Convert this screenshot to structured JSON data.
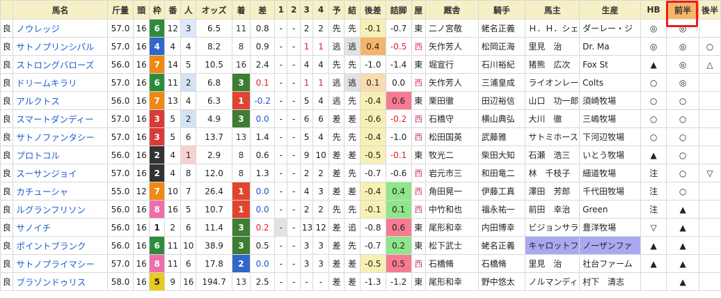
{
  "headers": [
    "",
    "馬名",
    "斤量",
    "頭",
    "枠",
    "番",
    "人",
    "オッズ",
    "着",
    "差",
    "1",
    "2",
    "3",
    "4",
    "予",
    "結",
    "後差",
    "詰脚",
    "屋",
    "厩舎",
    "騎手",
    "馬主",
    "生産",
    "HB",
    "前半",
    "後半"
  ],
  "rows": [
    {
      "baba": "良",
      "name": "ノウレッジ",
      "kin": "57.0",
      "to": "16",
      "waku": "6",
      "ban": "12",
      "nin": "3",
      "odds": "6.5",
      "chaku": "11",
      "sa": "0.8",
      "c1": "-",
      "c2": "-",
      "c3": "2",
      "c4": "2",
      "yo": "先",
      "ke": "先",
      "kosa": "-0.1",
      "tsume": "-0.7",
      "ya": "東",
      "kyu": "二ノ宮敬",
      "kishu": "蛯名正義",
      "owner": "Ｈ．Ｈ．シェ",
      "seisan": "ダーレー・ジ",
      "hb": "◎",
      "zen": "◎",
      "kou": ""
    },
    {
      "baba": "良",
      "name": "サトノプリンシパル",
      "kin": "57.0",
      "to": "16",
      "waku": "4",
      "ban": "4",
      "nin": "4",
      "odds": "8.2",
      "chaku": "8",
      "sa": "0.9",
      "c1": "-",
      "c2": "-",
      "c3": "1",
      "c4": "1",
      "yo": "逃",
      "ke": "逃",
      "kosa": "0.4",
      "tsume": "-0.5",
      "ya": "西",
      "kyu": "矢作芳人",
      "kishu": "松岡正海",
      "owner": "里見　治",
      "seisan": "Dr. Ma",
      "hb": "◎",
      "zen": "◎",
      "kou": "○"
    },
    {
      "baba": "良",
      "name": "ストロングバローズ",
      "kin": "56.0",
      "to": "16",
      "waku": "7",
      "ban": "14",
      "nin": "5",
      "odds": "10.5",
      "chaku": "16",
      "sa": "2.4",
      "c1": "-",
      "c2": "-",
      "c3": "4",
      "c4": "4",
      "yo": "先",
      "ke": "先",
      "kosa": "-1.0",
      "tsume": "-1.4",
      "ya": "東",
      "kyu": "堀宣行",
      "kishu": "石川裕紀",
      "owner": "猪熊　広次",
      "seisan": "Fox St",
      "hb": "▲",
      "zen": "◎",
      "kou": "△"
    },
    {
      "baba": "良",
      "name": "ドリームキラリ",
      "kin": "57.0",
      "to": "16",
      "waku": "6",
      "ban": "11",
      "nin": "2",
      "odds": "6.8",
      "chaku": "3",
      "sa": "0.1",
      "c1": "-",
      "c2": "-",
      "c3": "1",
      "c4": "1",
      "yo": "逃",
      "ke": "逃",
      "kosa": "0.1",
      "tsume": "0.0",
      "ya": "西",
      "kyu": "矢作芳人",
      "kishu": "三浦皇成",
      "owner": "ライオンレー",
      "seisan": "Colts",
      "hb": "○",
      "zen": "◎",
      "kou": ""
    },
    {
      "baba": "良",
      "name": "アルクトス",
      "kin": "56.0",
      "to": "16",
      "waku": "7",
      "ban": "13",
      "nin": "4",
      "odds": "6.3",
      "chaku": "1",
      "sa": "-0.2",
      "c1": "-",
      "c2": "-",
      "c3": "5",
      "c4": "4",
      "yo": "逃",
      "ke": "先",
      "kosa": "-0.4",
      "tsume": "0.6",
      "ya": "東",
      "kyu": "栗田徹",
      "kishu": "田辺裕信",
      "owner": "山口　功一郎",
      "seisan": "須崎牧場",
      "hb": "○",
      "zen": "○",
      "kou": ""
    },
    {
      "baba": "良",
      "name": "スマートダンディー",
      "kin": "57.0",
      "to": "16",
      "waku": "3",
      "ban": "5",
      "nin": "2",
      "odds": "4.9",
      "chaku": "3",
      "sa": "0.0",
      "c1": "-",
      "c2": "-",
      "c3": "6",
      "c4": "6",
      "yo": "差",
      "ke": "差",
      "kosa": "-0.6",
      "tsume": "-0.2",
      "ya": "西",
      "kyu": "石橋守",
      "kishu": "横山典弘",
      "owner": "大川　徹",
      "seisan": "三嶋牧場",
      "hb": "○",
      "zen": "○",
      "kou": ""
    },
    {
      "baba": "良",
      "name": "サトノファンタシー",
      "kin": "57.0",
      "to": "16",
      "waku": "3",
      "ban": "5",
      "nin": "6",
      "odds": "13.7",
      "chaku": "13",
      "sa": "1.4",
      "c1": "-",
      "c2": "-",
      "c3": "5",
      "c4": "4",
      "yo": "先",
      "ke": "先",
      "kosa": "-0.4",
      "tsume": "-1.0",
      "ya": "西",
      "kyu": "松田国英",
      "kishu": "武藤雅",
      "owner": "サトミホース",
      "seisan": "下河辺牧場",
      "hb": "○",
      "zen": "○",
      "kou": ""
    },
    {
      "baba": "良",
      "name": "プロトコル",
      "kin": "56.0",
      "to": "16",
      "waku": "2",
      "ban": "4",
      "nin": "1",
      "odds": "2.9",
      "chaku": "8",
      "sa": "0.6",
      "c1": "-",
      "c2": "-",
      "c3": "9",
      "c4": "10",
      "yo": "差",
      "ke": "差",
      "kosa": "-0.5",
      "tsume": "-0.1",
      "ya": "東",
      "kyu": "牧光二",
      "kishu": "柴田大知",
      "owner": "石瀬　浩三",
      "seisan": "いとう牧場",
      "hb": "▲",
      "zen": "○",
      "kou": ""
    },
    {
      "baba": "良",
      "name": "スーサンジョイ",
      "kin": "57.0",
      "to": "16",
      "waku": "2",
      "ban": "4",
      "nin": "8",
      "odds": "12.0",
      "chaku": "8",
      "sa": "1.3",
      "c1": "-",
      "c2": "-",
      "c3": "2",
      "c4": "2",
      "yo": "差",
      "ke": "先",
      "kosa": "-0.7",
      "tsume": "-0.6",
      "ya": "西",
      "kyu": "岩元市三",
      "kishu": "和田竜二",
      "owner": "林　千枝子",
      "seisan": "細道牧場",
      "hb": "注",
      "zen": "○",
      "kou": "▽"
    },
    {
      "baba": "良",
      "name": "カチューシャ",
      "kin": "55.0",
      "to": "12",
      "waku": "7",
      "ban": "10",
      "nin": "7",
      "odds": "26.4",
      "chaku": "1",
      "sa": "0.0",
      "c1": "-",
      "c2": "-",
      "c3": "4",
      "c4": "3",
      "yo": "差",
      "ke": "差",
      "kosa": "-0.4",
      "tsume": "0.4",
      "ya": "西",
      "kyu": "角田晃一",
      "kishu": "伊藤工真",
      "owner": "澤田　芳郎",
      "seisan": "千代田牧場",
      "hb": "注",
      "zen": "○",
      "kou": ""
    },
    {
      "baba": "良",
      "name": "ルグランフリソン",
      "kin": "56.0",
      "to": "16",
      "waku": "8",
      "ban": "16",
      "nin": "5",
      "odds": "10.7",
      "chaku": "1",
      "sa": "0.0",
      "c1": "-",
      "c2": "-",
      "c3": "2",
      "c4": "2",
      "yo": "先",
      "ke": "先",
      "kosa": "-0.1",
      "tsume": "0.1",
      "ya": "西",
      "kyu": "中竹和也",
      "kishu": "福永祐一",
      "owner": "前田　幸治",
      "seisan": "Green",
      "hb": "注",
      "zen": "▲",
      "kou": ""
    },
    {
      "baba": "良",
      "name": "サノイチ",
      "kin": "56.0",
      "to": "16",
      "waku": "1",
      "ban": "2",
      "nin": "6",
      "odds": "11.4",
      "chaku": "3",
      "sa": "0.2",
      "c1": "-",
      "c2": "-",
      "c3": "13",
      "c4": "12",
      "yo": "差",
      "ke": "追",
      "kosa": "-0.8",
      "tsume": "0.6",
      "ya": "東",
      "kyu": "尾形和幸",
      "kishu": "内田博幸",
      "owner": "ビジョンサラ",
      "seisan": "豊洋牧場",
      "hb": "▽",
      "zen": "▲",
      "kou": ""
    },
    {
      "baba": "良",
      "name": "ポイントブランク",
      "kin": "56.0",
      "to": "16",
      "waku": "6",
      "ban": "11",
      "nin": "10",
      "odds": "38.9",
      "chaku": "3",
      "sa": "0.5",
      "c1": "-",
      "c2": "-",
      "c3": "3",
      "c4": "3",
      "yo": "差",
      "ke": "先",
      "kosa": "-0.7",
      "tsume": "0.2",
      "ya": "東",
      "kyu": "松下武士",
      "kishu": "蛯名正義",
      "owner": "キャロットフ",
      "seisan": "ノーザンファ",
      "hb": "▲",
      "zen": "▲",
      "kou": ""
    },
    {
      "baba": "良",
      "name": "サトノプライマシー",
      "kin": "57.0",
      "to": "16",
      "waku": "8",
      "ban": "11",
      "nin": "6",
      "odds": "17.8",
      "chaku": "2",
      "sa": "0.0",
      "c1": "-",
      "c2": "-",
      "c3": "3",
      "c4": "3",
      "yo": "差",
      "ke": "差",
      "kosa": "-0.5",
      "tsume": "0.5",
      "ya": "西",
      "kyu": "石橋脩",
      "kishu": "石橋脩",
      "owner": "里見　治",
      "seisan": "社台ファーム",
      "hb": "▲",
      "zen": "▲",
      "kou": ""
    },
    {
      "baba": "良",
      "name": "ブラゾンドゥリス",
      "kin": "58.0",
      "to": "16",
      "waku": "5",
      "ban": "9",
      "nin": "16",
      "odds": "194.7",
      "chaku": "13",
      "sa": "2.5",
      "c1": "-",
      "c2": "-",
      "c3": "-",
      "c4": "-",
      "yo": "差",
      "ke": "差",
      "kosa": "-1.3",
      "tsume": "-1.2",
      "ya": "東",
      "kyu": "尾形和幸",
      "kishu": "野中悠太",
      "owner": "ノルマンディ",
      "seisan": "村下　清志",
      "hb": "",
      "zen": "▲",
      "kou": ""
    }
  ]
}
